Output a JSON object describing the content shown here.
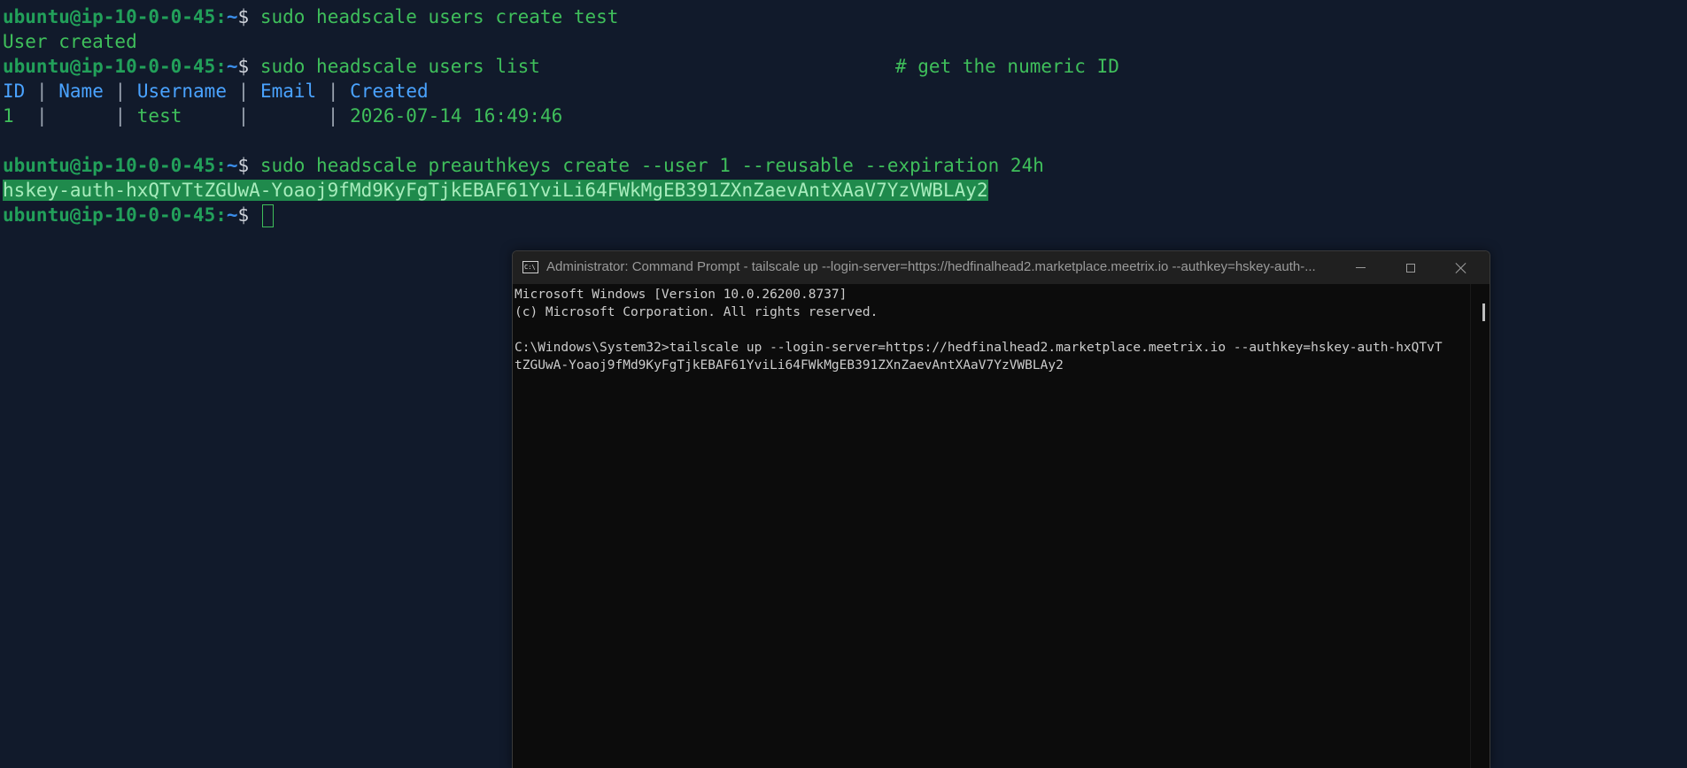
{
  "terminal": {
    "prompt": {
      "user_host": "ubuntu@ip-10-0-0-45",
      "colon": ":",
      "path": "~",
      "sign": "$"
    },
    "lines": {
      "cmd1": "sudo headscale users create test",
      "out1": "User created",
      "cmd2": "sudo headscale users list",
      "cmd2_comment": "# get the numeric ID",
      "cmd3": "sudo headscale preauthkeys create --user 1 --reusable --expiration 24h",
      "key_output": "hskey-auth-hxQTvTtZGUwA-Yoaoj9fMd9KyFgTjkEBAF61YviLi64FWkMgEB391ZXnZaevAntXAaV7YzVWBLAy2"
    },
    "users_table": {
      "headers": [
        "ID",
        "Name",
        "Username",
        "Email",
        "Created"
      ],
      "row": [
        "1",
        "",
        "test",
        "",
        "2026-07-14 16:49:46"
      ]
    },
    "colors": {
      "background": "#111a2b",
      "prompt_user": "#22a05a",
      "prompt_path": "#3b8eea",
      "text": "#3fbf5b",
      "header": "#4aa3ff",
      "selection": "#1f8a4c"
    }
  },
  "cmd_window": {
    "title": "Administrator: Command Prompt - tailscale  up --login-server=https://hedfinalhead2.marketplace.meetrix.io --authkey=hskey-auth-...",
    "icon": "cmd-icon",
    "icon_label": "C:\\",
    "controls": {
      "minimize": "minimize-icon",
      "maximize": "maximize-icon",
      "close": "close-icon"
    },
    "console": {
      "line1": "Microsoft Windows [Version 10.0.26200.8737]",
      "line2": "(c) Microsoft Corporation. All rights reserved.",
      "line3": "C:\\Windows\\System32>tailscale up --login-server=https://hedfinalhead2.marketplace.meetrix.io --authkey=hskey-auth-hxQTvT",
      "line4": "tZGUwA-Yoaoj9fMd9KyFgTjkEBAF61YviLi64FWkMgEB391ZXnZaevAntXAaV7YzVWBLAy2"
    },
    "colors": {
      "background": "#0c0c0c",
      "titlebar": "#202020",
      "text": "#cccccc"
    }
  }
}
